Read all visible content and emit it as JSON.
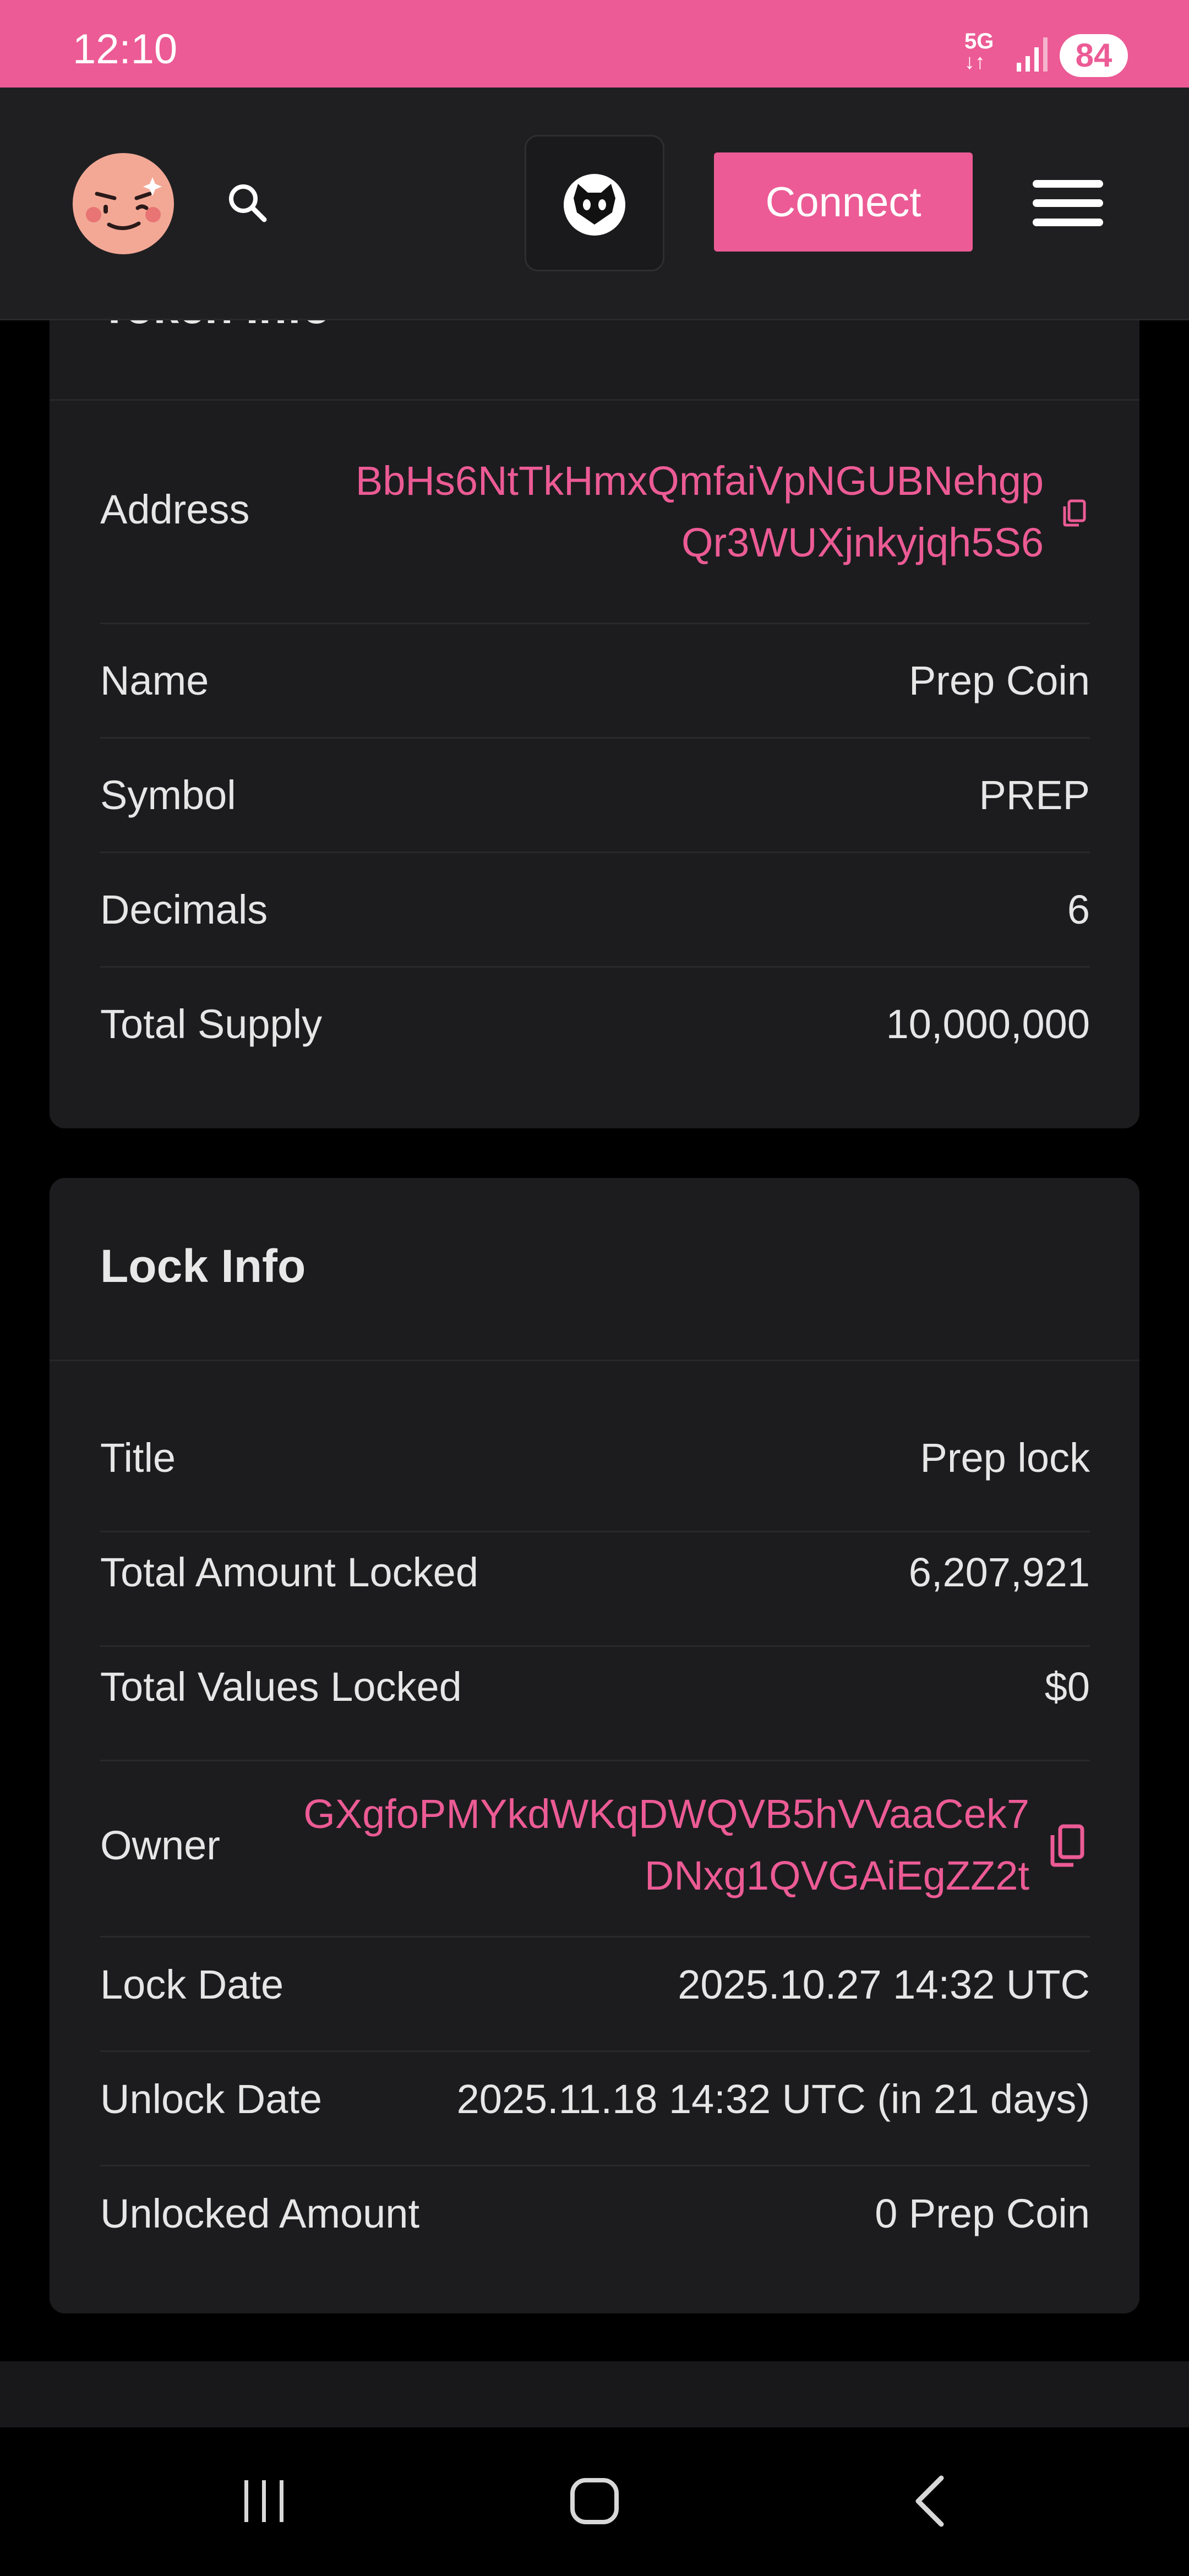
{
  "status_bar": {
    "time": "12:10",
    "network_line1": "5G",
    "network_line2": "↓↑",
    "battery": "84",
    "background": "#EC5B95"
  },
  "header": {
    "avatar_icon": "winking-face-avatar-icon",
    "search_icon": "search-icon",
    "logo_icon": "cat-logo-icon",
    "connect_label": "Connect",
    "menu_icon": "hamburger-menu-icon",
    "accent": "#EC5B95"
  },
  "token_info": {
    "title": "Token Info",
    "address_label": "Address",
    "address_line1": "BbHs6NtTkHmxQmfaiVpNGUBNehgp",
    "address_line2": "Qr3WUXjnkyjqh5S6",
    "name_label": "Name",
    "name_value": "Prep Coin",
    "symbol_label": "Symbol",
    "symbol_value": "PREP",
    "decimals_label": "Decimals",
    "decimals_value": "6",
    "supply_label": "Total Supply",
    "supply_value": "10,000,000"
  },
  "lock_info": {
    "title": "Lock Info",
    "title_label": "Title",
    "title_value": "Prep lock",
    "amount_label": "Total Amount Locked",
    "amount_value": "6,207,921",
    "values_label": "Total Values Locked",
    "values_value": "$0",
    "owner_label": "Owner",
    "owner_line1": "GXgfoPMYkdWKqDWQVB5hVVaaCek7",
    "owner_line2": "DNxg1QVGAiEgZZ2t",
    "lock_date_label": "Lock Date",
    "lock_date_value": "2025.10.27 14:32 UTC",
    "unlock_date_label": "Unlock Date",
    "unlock_date_value": "2025.11.18 14:32 UTC (in 21 days)",
    "unlocked_label": "Unlocked Amount",
    "unlocked_value": "0 Prep Coin"
  },
  "nav_bar": {
    "recents_icon": "recent-apps-icon",
    "home_icon": "home-icon",
    "back_icon": "back-icon"
  }
}
